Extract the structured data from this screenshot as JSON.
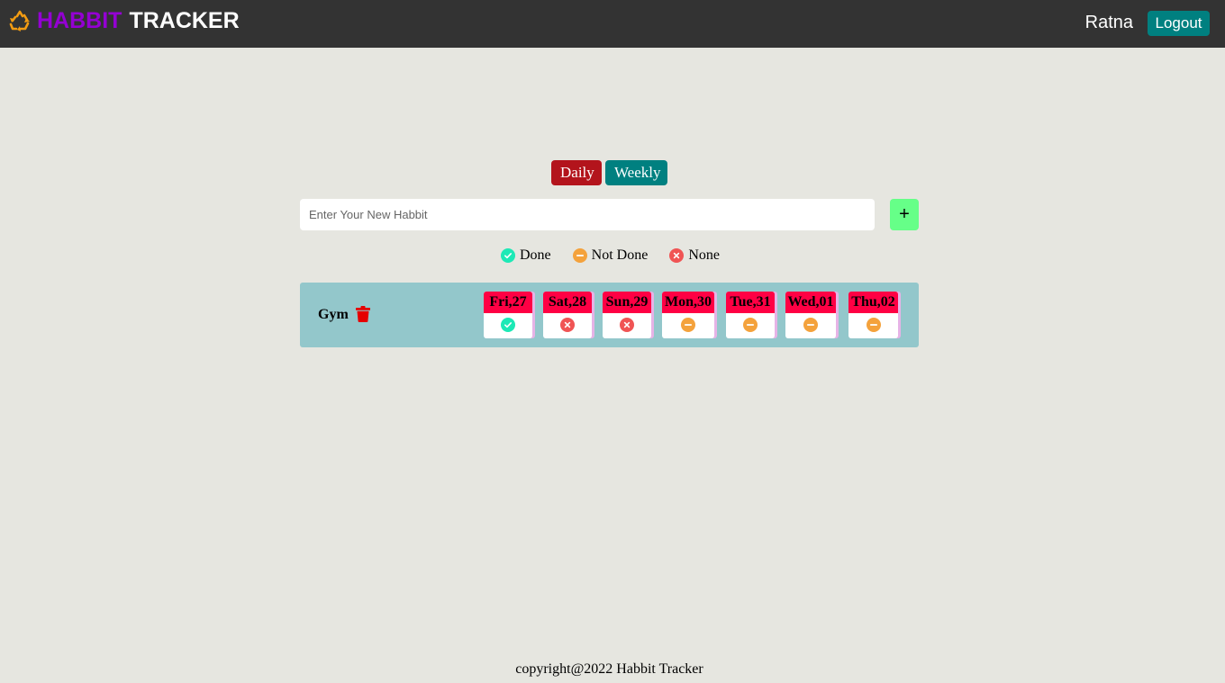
{
  "header": {
    "brand_part1": "HABBIT",
    "brand_part2": "TRACKER",
    "user_name": "Ratna",
    "logout_label": "Logout"
  },
  "tabs": [
    {
      "label": "Daily"
    },
    {
      "label": "Weekly"
    }
  ],
  "habit_form": {
    "placeholder": "Enter Your New Habbit",
    "value": "",
    "add_label": "+"
  },
  "legend": [
    {
      "label": "Done",
      "status": "done"
    },
    {
      "label": "Not Done",
      "status": "not-done"
    },
    {
      "label": "None",
      "status": "none"
    }
  ],
  "habit": {
    "name": "Gym",
    "days": [
      {
        "label": "Fri,27",
        "status": "done"
      },
      {
        "label": "Sat,28",
        "status": "none"
      },
      {
        "label": "Sun,29",
        "status": "none"
      },
      {
        "label": "Mon,30",
        "status": "not-done"
      },
      {
        "label": "Tue,31",
        "status": "not-done"
      },
      {
        "label": "Wed,01",
        "status": "not-done"
      },
      {
        "label": "Thu,02",
        "status": "not-done"
      }
    ]
  },
  "colors": {
    "done": "#1de9b6",
    "not_done": "#f4a23c",
    "none": "#f05454",
    "brand_accent": "#9400d3",
    "navbar": "#333333",
    "day_header": "#ff0044"
  },
  "icons": {
    "done": "check-circle-icon",
    "not_done": "minus-circle-icon",
    "none": "x-circle-icon",
    "delete": "trash-icon",
    "logo": "recycle-icon"
  },
  "footer": {
    "text": "copyright@2022 Habbit Tracker"
  }
}
